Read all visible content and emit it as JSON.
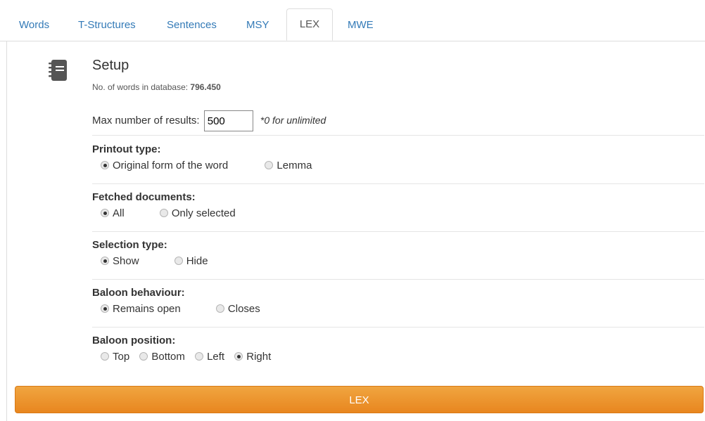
{
  "tabs": [
    {
      "label": "Words"
    },
    {
      "label": "T-Structures"
    },
    {
      "label": "Sentences"
    },
    {
      "label": "MSY"
    },
    {
      "label": "LEX",
      "active": true
    },
    {
      "label": "MWE"
    }
  ],
  "setup": {
    "icon": "notebook-icon",
    "title": "Setup",
    "words_label": "No. of words in database: ",
    "words_count": "796.450"
  },
  "max_results": {
    "label": "Max number of results:",
    "value": "500",
    "hint": "*0 for unlimited"
  },
  "printout": {
    "label": "Printout type:",
    "options": [
      "Original form of the word",
      "Lemma"
    ],
    "selected": "Original form of the word"
  },
  "fetched": {
    "label": "Fetched documents:",
    "options": [
      "All",
      "Only selected"
    ],
    "selected": "All"
  },
  "selection": {
    "label": "Selection type:",
    "options": [
      "Show",
      "Hide"
    ],
    "selected": "Show"
  },
  "baloon_behaviour": {
    "label": "Baloon behaviour:",
    "options": [
      "Remains open",
      "Closes"
    ],
    "selected": "Remains open"
  },
  "baloon_position": {
    "label": "Baloon position:",
    "options": [
      "Top",
      "Bottom",
      "Left",
      "Right"
    ],
    "selected": "Right"
  },
  "submit": {
    "label": "LEX"
  },
  "colors": {
    "accent": "#ec9430",
    "link": "#337ab7"
  }
}
